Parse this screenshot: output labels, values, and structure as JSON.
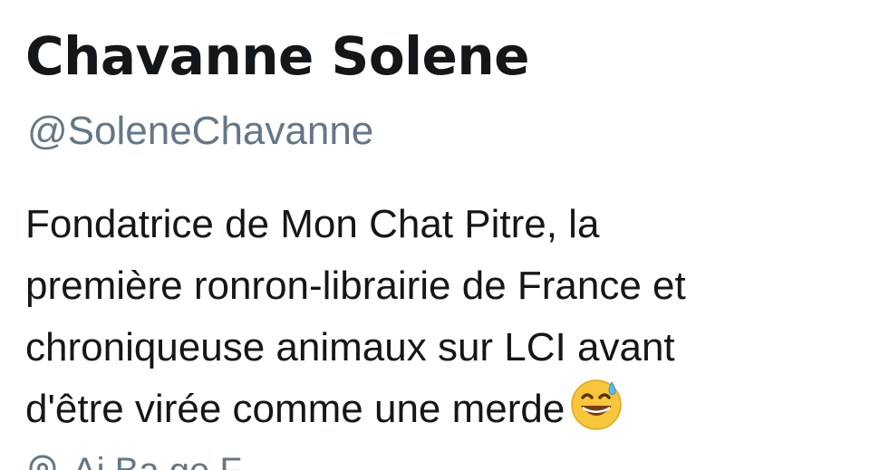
{
  "profile": {
    "display_name": "Chavanne Solene",
    "handle": "@SoleneChavanne",
    "bio_lines": [
      "Fondatrice de Mon Chat Pitre, la",
      "première ronron-librairie de France et",
      "chroniqueuse animaux sur LCI avant",
      "d'être virée comme une merde"
    ],
    "bio_emoji": "grinning-face-with-sweat-emoji",
    "meta": {
      "location_icon": "location-pin-icon",
      "location_partial": "Ai     Ba     ge  F"
    }
  },
  "colors": {
    "text_primary": "#14171a",
    "text_secondary": "#657786"
  }
}
